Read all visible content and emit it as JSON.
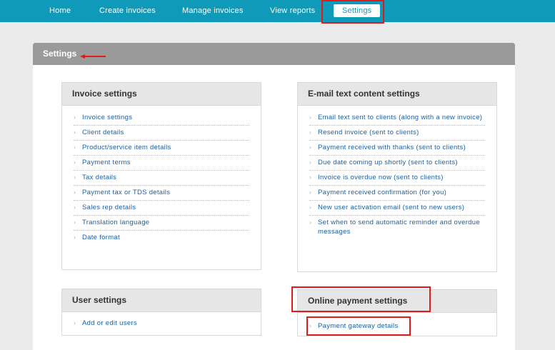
{
  "nav": {
    "items": [
      "Home",
      "Create invoices",
      "Manage invoices",
      "View reports"
    ],
    "active": "Settings"
  },
  "panel": {
    "title": "Settings"
  },
  "invoice_settings": {
    "title": "Invoice settings",
    "links": [
      "Invoice settings",
      "Client details",
      "Product/service item details",
      "Payment terms",
      "Tax details",
      "Payment tax or TDS details",
      "Sales rep details",
      "Translation language",
      "Date format"
    ]
  },
  "email_settings": {
    "title": "E-mail text content settings",
    "links": [
      "Email text sent to clients (along with a new invoice)",
      "Resend invoice (sent to clients)",
      "Payment received with thanks (sent to clients)",
      "Due date coming up shortly (sent to clients)",
      "Invoice is overdue now (sent to clients)",
      "Payment received confirmation (for you)",
      "New user activation email (sent to new users)",
      "Set when to send automatic reminder and overdue messages"
    ]
  },
  "user_settings": {
    "title": "User settings",
    "links": [
      "Add or edit users"
    ]
  },
  "online_payment_settings": {
    "title": "Online payment settings",
    "links": [
      "Payment gateway details"
    ]
  },
  "colors": {
    "nav_bg": "#0e9ab8",
    "link": "#1d5fa3",
    "annotation": "#e01b1b",
    "panel_header": "#9a9a9a"
  },
  "icons": {
    "bullet": "chevron-right-icon",
    "annotation_arrow": "arrow-left-icon"
  }
}
